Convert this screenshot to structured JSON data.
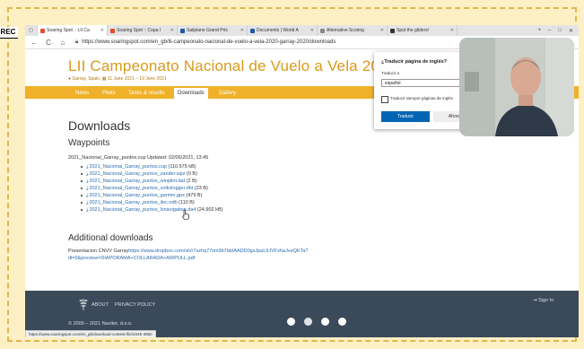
{
  "browser": {
    "tabs": [
      {
        "label": "Soaring Spot :: LII Ca",
        "icon": "soaringspot-favicon",
        "color": "#e44b2c",
        "active": true
      },
      {
        "label": "Soaring Spot :: Copa I",
        "icon": "soaringspot-favicon",
        "color": "#e44b2c",
        "active": false
      },
      {
        "label": "Sailplane Grand Prix",
        "icon": "sgp-favicon",
        "color": "#1a5aa8",
        "active": false
      },
      {
        "label": "Documents | World A",
        "icon": "docs-favicon",
        "color": "#1a5aa8",
        "active": false
      },
      {
        "label": "Alternative Scoring",
        "icon": "page-favicon",
        "color": "#888888",
        "active": false
      },
      {
        "label": "Spot the gliders!",
        "icon": "spot-favicon",
        "color": "#333333",
        "active": false
      }
    ],
    "url": "https://www.soaringspot.com/en_gb/lii-campeonato-nacional-de-vuelo-a-vela-2020-garray-2020/downloads",
    "status_url": "https://www.soaringspot.com/en_gb/download-contest-file/2045-3960"
  },
  "rec_label": "REC",
  "site": {
    "title": "LII Campeonato Nacional de Vuelo a Vela 2021",
    "location": "Garray, Spain,",
    "dates": "11 June 2021 – 19 June 2021",
    "nav": [
      "News",
      "Pilots",
      "Tasks & results",
      "Downloads",
      "Gallery"
    ],
    "active_nav": "Downloads"
  },
  "content": {
    "heading": "Downloads",
    "waypoints_heading": "Waypoints",
    "updated_text": "2021_Nacional_Garray_puntos.cup Updated: 02/06/2021, 13:45",
    "files": [
      {
        "name": "2021_Nacional_Garray_puntos.cup",
        "size": "(110.575 kB)"
      },
      {
        "name": "2021_Nacional_Garray_puntos_zander.wpz",
        "size": "(0 B)"
      },
      {
        "name": "2021_Nacional_Garray_puntos_winpilot.dat",
        "size": "(2 B)"
      },
      {
        "name": "2021_Nacional_Garray_puntos_volkslogger.dbt",
        "size": "(23 B)"
      },
      {
        "name": "2021_Nacional_Garray_puntos_garmin.gpx",
        "size": "(479 B)"
      },
      {
        "name": "2021_Nacional_Garray_puntos_ilec.ndb",
        "size": "(110 B)"
      },
      {
        "name": "2021_Nacional_Garray_puntos_lxnavigation.da4",
        "size": "(24.902 kB)"
      }
    ],
    "additional_heading": "Additional downloads",
    "presentation_label": "Presentacion CNVV Garray",
    "presentation_link": "https://www.dropbox.com/sh/r7szhq77sm9b7bb/AADD0gsJpaL9JVFzhaJveQKTa?dl=0&preview=DIAPORAMA+COLLARADA+AIRPULL.pdf"
  },
  "footer": {
    "links": [
      "ABOUT",
      "PRIVACY POLICY"
    ],
    "copyright": "© 2000 – 2021 Naviter, d.o.o.",
    "signin": "Sign In",
    "page_dots": 4,
    "active_dot": 1
  },
  "translate_popup": {
    "title": "¿Traducir página de inglés?",
    "label": "Traducir a",
    "language": "español",
    "checkbox_label": "Traducir siempre páginas de inglés",
    "translate_button": "Traducir",
    "not_now_button": "Ahora no"
  }
}
